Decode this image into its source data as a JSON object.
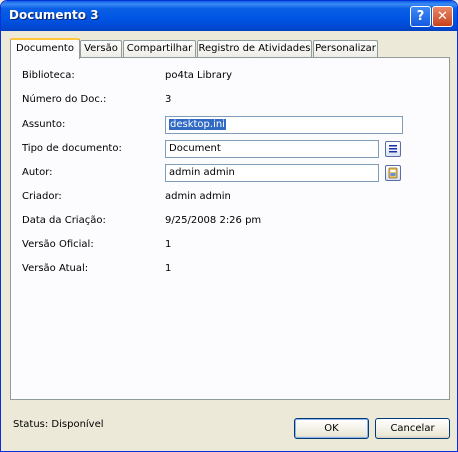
{
  "window": {
    "title": "Documento 3"
  },
  "titlebar_buttons": {
    "help": "?",
    "close": "✕"
  },
  "tabs": [
    {
      "label": "Documento"
    },
    {
      "label": "Versão"
    },
    {
      "label": "Compartilhar"
    },
    {
      "label": "Registro de Atividades"
    },
    {
      "label": "Personalizar"
    }
  ],
  "fields": {
    "biblioteca": {
      "label": "Biblioteca:",
      "value": "po4ta Library"
    },
    "numero_doc": {
      "label": "Número do Doc.:",
      "value": "3"
    },
    "assunto": {
      "label": "Assunto:",
      "value": "desktop.ini"
    },
    "tipo_documento": {
      "label": "Tipo de documento:",
      "value": "Document"
    },
    "autor": {
      "label": "Autor:",
      "value": "admin admin"
    },
    "criador": {
      "label": "Criador:",
      "value": "admin admin"
    },
    "data_criacao": {
      "label": "Data da Criação:",
      "value": "9/25/2008 2:26 pm"
    },
    "versao_oficial": {
      "label": "Versão Oficial:",
      "value": "1"
    },
    "versao_atual": {
      "label": "Versão Atual:",
      "value": "1"
    }
  },
  "icons": {
    "list": "list-icon",
    "user": "user-picker-icon"
  },
  "status": {
    "text": "Status: Disponível"
  },
  "buttons": {
    "ok": "OK",
    "cancel": "Cancelar"
  },
  "colors": {
    "titlebar": "#0054e3",
    "selection": "#316ac5",
    "tab_highlight": "#ffc83c"
  }
}
